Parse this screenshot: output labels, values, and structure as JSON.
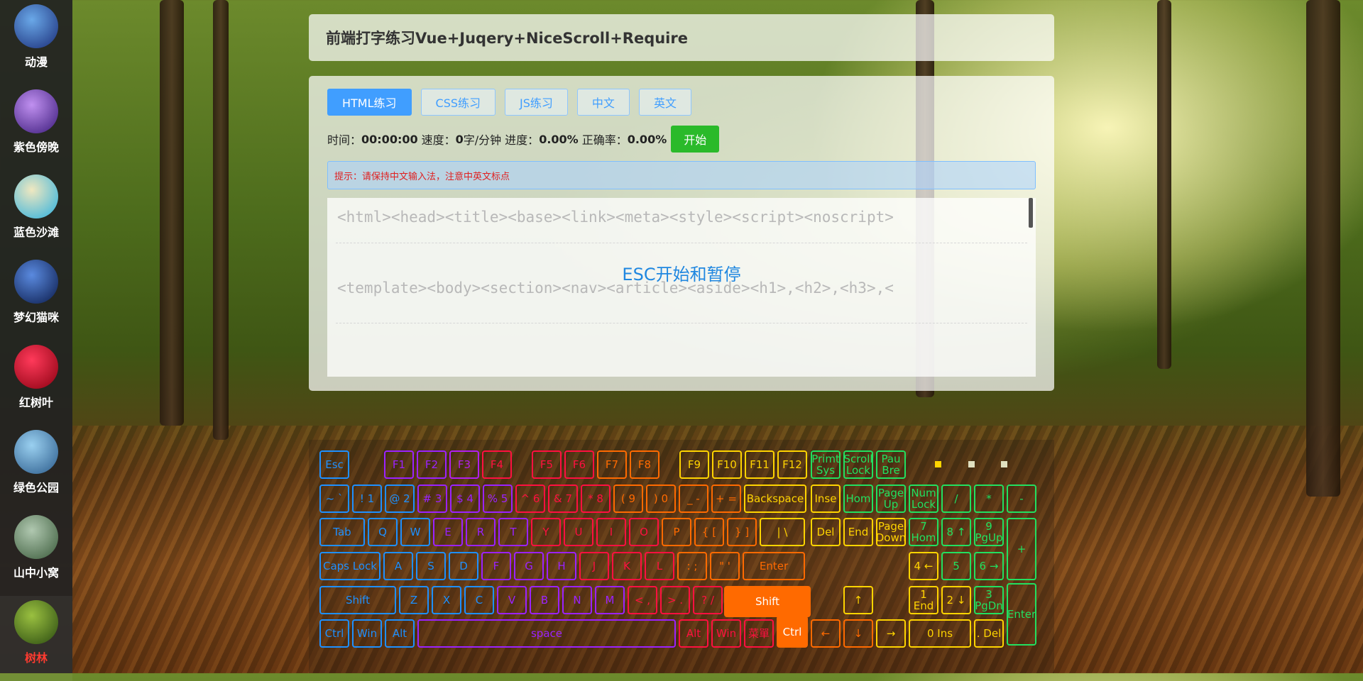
{
  "sidebar": {
    "items": [
      {
        "label": "动漫",
        "colors": [
          "#1a2d78",
          "#6aa8e8"
        ]
      },
      {
        "label": "紫色傍晚",
        "colors": [
          "#3a1a7a",
          "#c090f0"
        ]
      },
      {
        "label": "蓝色沙滩",
        "colors": [
          "#2ab0e0",
          "#f0e8c0"
        ]
      },
      {
        "label": "梦幻猫咪",
        "colors": [
          "#0a1a4a",
          "#5a8adf"
        ]
      },
      {
        "label": "红树叶",
        "colors": [
          "#8a0010",
          "#ff3a5a"
        ]
      },
      {
        "label": "绿色公园",
        "colors": [
          "#2a5a8a",
          "#9ad0f0"
        ]
      },
      {
        "label": "山中小窝",
        "colors": [
          "#3a5a3a",
          "#b0c8b0"
        ]
      },
      {
        "label": "树林",
        "colors": [
          "#2a4a10",
          "#9ac040"
        ],
        "active": true
      }
    ]
  },
  "header": {
    "title": "前端打字练习Vue+Juqery+NiceScroll+Require"
  },
  "tabs": [
    {
      "label": "HTML练习",
      "active": true
    },
    {
      "label": "CSS练习"
    },
    {
      "label": "JS练习"
    },
    {
      "label": "中文"
    },
    {
      "label": "英文"
    }
  ],
  "stats": {
    "time_label": "时间：",
    "time": "00:00:00",
    "speed_label": "速度：",
    "speed": "0",
    "speed_unit": "字/分钟",
    "progress_label": "进度：",
    "progress": "0.00%",
    "accuracy_label": "正确率：",
    "accuracy": "0.00%",
    "start_label": "开始"
  },
  "hint": "提示：请保持中文输入法，注意中英文标点",
  "practice": {
    "line1": "<html><head><title><base><link><meta><style><script><noscript>",
    "line2": "<template><body><section><nav><article><aside><h1>,<h2>,<h3>,<",
    "esc_tip": "ESC开始和暂停"
  },
  "keyboard": {
    "keys": [
      {
        "t": "Esc",
        "c": "#1e90ff"
      },
      {
        "t": "F1",
        "c": "#9b22ff"
      },
      {
        "t": "F2",
        "c": "#9b22ff"
      },
      {
        "t": "F3",
        "c": "#b21ff0"
      },
      {
        "t": "F4",
        "c": "#ff1040"
      },
      {
        "t": "F5",
        "c": "#ff1040"
      },
      {
        "t": "F6",
        "c": "#ff1040"
      },
      {
        "t": "F7",
        "c": "#ff6a00"
      },
      {
        "t": "F8",
        "c": "#ff6a00"
      },
      {
        "t": "F9",
        "c": "#ffd400"
      },
      {
        "t": "F10",
        "c": "#ffd400"
      },
      {
        "t": "F11",
        "c": "#ffd400"
      },
      {
        "t": "F12",
        "c": "#ffd400"
      },
      {
        "t": "Primt Sys",
        "c": "#22e060"
      },
      {
        "t": "Scroll Lock",
        "c": "#22e060"
      },
      {
        "t": "Pau Bre",
        "c": "#22e060"
      },
      {
        "t": "~ `",
        "c": "#1e90ff"
      },
      {
        "t": "! 1",
        "c": "#1e90ff"
      },
      {
        "t": "@ 2",
        "c": "#1e90ff"
      },
      {
        "t": "# 3",
        "c": "#9b22ff"
      },
      {
        "t": "$ 4",
        "c": "#9b22ff"
      },
      {
        "t": "% 5",
        "c": "#9b22ff"
      },
      {
        "t": "^ 6",
        "c": "#ff1040"
      },
      {
        "t": "& 7",
        "c": "#ff1040"
      },
      {
        "t": "* 8",
        "c": "#ff1040"
      },
      {
        "t": "( 9",
        "c": "#ff6a00"
      },
      {
        "t": ") 0",
        "c": "#ff6a00"
      },
      {
        "t": "_ -",
        "c": "#ff6a00"
      },
      {
        "t": "+ =",
        "c": "#ff6a00"
      },
      {
        "t": "Backspace",
        "c": "#ffd400"
      },
      {
        "t": "Inse",
        "c": "#ffd400"
      },
      {
        "t": "Hom",
        "c": "#22e060"
      },
      {
        "t": "Page Up",
        "c": "#22e060"
      },
      {
        "t": "Num Lock",
        "c": "#22e060"
      },
      {
        "t": "/",
        "c": "#22e060"
      },
      {
        "t": "*",
        "c": "#22e060"
      },
      {
        "t": "-",
        "c": "#22e060"
      },
      {
        "t": "Tab",
        "c": "#1e90ff"
      },
      {
        "t": "Q",
        "c": "#1e90ff"
      },
      {
        "t": "W",
        "c": "#1e90ff"
      },
      {
        "t": "E",
        "c": "#9b22ff"
      },
      {
        "t": "R",
        "c": "#9b22ff"
      },
      {
        "t": "T",
        "c": "#9b22ff"
      },
      {
        "t": "Y",
        "c": "#ff1040"
      },
      {
        "t": "U",
        "c": "#ff1040"
      },
      {
        "t": "I",
        "c": "#ff1040"
      },
      {
        "t": "O",
        "c": "#ff1040"
      },
      {
        "t": "P",
        "c": "#ff6a00"
      },
      {
        "t": "{ [",
        "c": "#ff6a00"
      },
      {
        "t": "} ]",
        "c": "#ff6a00"
      },
      {
        "t": "| \\",
        "c": "#ffd400"
      },
      {
        "t": "Del",
        "c": "#ffd400"
      },
      {
        "t": "End",
        "c": "#ffd400"
      },
      {
        "t": "Page Down",
        "c": "#ffd400"
      },
      {
        "t": "7 Hom",
        "c": "#22e060"
      },
      {
        "t": "8 ↑",
        "c": "#22e060"
      },
      {
        "t": "9 PgUp",
        "c": "#22e060"
      },
      {
        "t": "+",
        "c": "#22e060"
      },
      {
        "t": "Caps Lock",
        "c": "#1e90ff"
      },
      {
        "t": "A",
        "c": "#1e90ff"
      },
      {
        "t": "S",
        "c": "#1e90ff"
      },
      {
        "t": "D",
        "c": "#1e90ff"
      },
      {
        "t": "F",
        "c": "#9b22ff"
      },
      {
        "t": "G",
        "c": "#9b22ff"
      },
      {
        "t": "H",
        "c": "#9b22ff"
      },
      {
        "t": "J",
        "c": "#ff1040"
      },
      {
        "t": "K",
        "c": "#ff1040"
      },
      {
        "t": "L",
        "c": "#ff1040"
      },
      {
        "t": ": ;",
        "c": "#ff6a00"
      },
      {
        "t": "\" '",
        "c": "#ff6a00"
      },
      {
        "t": "Enter",
        "c": "#ff6a00"
      },
      {
        "t": "4 ←",
        "c": "#ffd400"
      },
      {
        "t": "5",
        "c": "#22e060"
      },
      {
        "t": "6 →",
        "c": "#22e060"
      },
      {
        "t": "Shift",
        "c": "#1e90ff"
      },
      {
        "t": "Z",
        "c": "#1e90ff"
      },
      {
        "t": "X",
        "c": "#1e90ff"
      },
      {
        "t": "C",
        "c": "#1e90ff"
      },
      {
        "t": "V",
        "c": "#9b22ff"
      },
      {
        "t": "B",
        "c": "#9b22ff"
      },
      {
        "t": "N",
        "c": "#9b22ff"
      },
      {
        "t": "M",
        "c": "#9b22ff"
      },
      {
        "t": "< ,",
        "c": "#ff1040"
      },
      {
        "t": "> .",
        "c": "#ff1040"
      },
      {
        "t": "? /",
        "c": "#ff1040"
      },
      {
        "t": "Shift",
        "c": "#ff6a00",
        "hl": true
      },
      {
        "t": "↑",
        "c": "#ffd400"
      },
      {
        "t": "1 End",
        "c": "#ffd400"
      },
      {
        "t": "2 ↓",
        "c": "#ffd400"
      },
      {
        "t": "3 PgDn",
        "c": "#22e060"
      },
      {
        "t": "Enter",
        "c": "#22e060"
      },
      {
        "t": "Ctrl",
        "c": "#1e90ff"
      },
      {
        "t": "Win",
        "c": "#1e90ff"
      },
      {
        "t": "Alt",
        "c": "#1e90ff"
      },
      {
        "t": "space",
        "c": "#9b22ff"
      },
      {
        "t": "Alt",
        "c": "#ff1040"
      },
      {
        "t": "Win",
        "c": "#ff1040"
      },
      {
        "t": "菜單",
        "c": "#ff1040"
      },
      {
        "t": "Ctrl",
        "c": "#ff6a00",
        "hl": true
      },
      {
        "t": "←",
        "c": "#ff6a00"
      },
      {
        "t": "↓",
        "c": "#ff6a00"
      },
      {
        "t": "→",
        "c": "#ffd400"
      },
      {
        "t": "0 Ins",
        "c": "#ffd400"
      },
      {
        "t": ". Del",
        "c": "#ffd400"
      }
    ]
  }
}
